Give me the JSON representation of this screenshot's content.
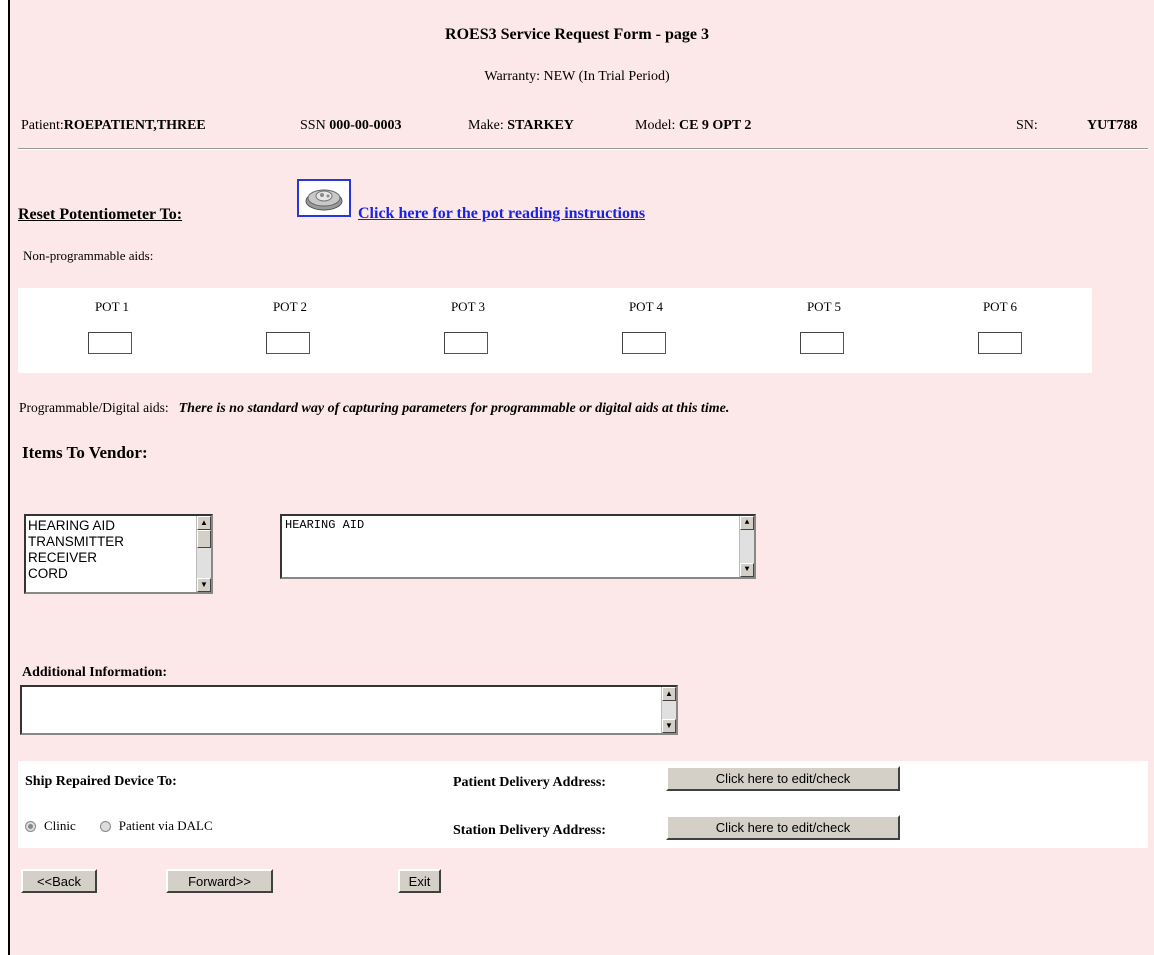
{
  "title": "ROES3 Service Request Form - page 3",
  "warranty": {
    "label": "Warranty:",
    "value": "NEW (In Trial Period)"
  },
  "patient_info": {
    "patient_label": "Patient:",
    "patient_value": "ROEPATIENT,THREE",
    "ssn_label": "SSN",
    "ssn_value": "000-00-0003",
    "make_label": "Make:",
    "make_value": "STARKEY",
    "model_label": "Model:",
    "model_value": "CE 9 OPT 2",
    "sn_label": "SN:",
    "sn_value": "YUT788"
  },
  "reset": {
    "heading": "Reset Potentiometer To:",
    "link": "Click here for the pot reading instructions",
    "icon": "hearing-aid-pot-icon"
  },
  "nonprog_label": "Non-programmable aids:",
  "pots": [
    {
      "label": "POT 1",
      "value": ""
    },
    {
      "label": "POT 2",
      "value": ""
    },
    {
      "label": "POT 3",
      "value": ""
    },
    {
      "label": "POT 4",
      "value": ""
    },
    {
      "label": "POT 5",
      "value": ""
    },
    {
      "label": "POT 6",
      "value": ""
    }
  ],
  "programmable": {
    "label": "Programmable/Digital aids:",
    "note": "There is no standard way of capturing parameters for programmable or digital aids at this time."
  },
  "items": {
    "heading": "Items To Vendor:",
    "options": [
      "HEARING AID",
      "TRANSMITTER",
      "RECEIVER",
      "CORD"
    ],
    "selected_text": "HEARING AID"
  },
  "additional": {
    "heading": "Additional Information:",
    "value": ""
  },
  "ship": {
    "heading": "Ship Repaired Device To:",
    "options": [
      {
        "label": "Clinic",
        "selected": true
      },
      {
        "label": "Patient via DALC",
        "selected": false
      }
    ],
    "patient_address_label": "Patient Delivery Address:",
    "station_address_label": "Station Delivery Address:",
    "edit_button_label": "Click here to edit/check"
  },
  "nav": {
    "back": "<<Back",
    "forward": "Forward>>",
    "exit": "Exit"
  },
  "colors": {
    "background": "#fce8e8",
    "link": "#1a24e0",
    "button": "#d4d0c8"
  }
}
